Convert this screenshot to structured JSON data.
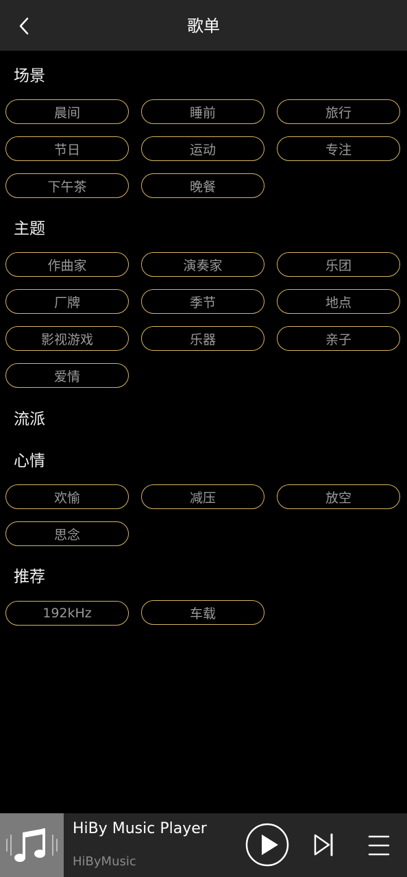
{
  "header": {
    "title": "歌单"
  },
  "sections": {
    "scene": {
      "title": "场景",
      "items": [
        "晨间",
        "睡前",
        "旅行",
        "节日",
        "运动",
        "专注",
        "下午茶",
        "晚餐"
      ]
    },
    "theme": {
      "title": "主题",
      "items": [
        "作曲家",
        "演奏家",
        "乐团",
        "厂牌",
        "季节",
        "地点",
        "影视游戏",
        "乐器",
        "亲子",
        "爱情"
      ]
    },
    "genre": {
      "title": "流派",
      "items": []
    },
    "mood": {
      "title": "心情",
      "items": [
        "欢愉",
        "减压",
        "放空",
        "思念"
      ]
    },
    "recommend": {
      "title": "推荐",
      "items": [
        "192kHz",
        "车载"
      ]
    }
  },
  "player": {
    "track_title": "HiBy Music Player",
    "artist": "HiByMusic",
    "icons": [
      "music-note-icon",
      "play-icon",
      "skip-next-icon",
      "playlist-menu-icon"
    ]
  },
  "colors": {
    "background": "#000000",
    "header_bg": "#262626",
    "chip_border": "#d8b75f",
    "chip_text": "#9a9a9a",
    "cover_bg": "#7b7b7b"
  }
}
